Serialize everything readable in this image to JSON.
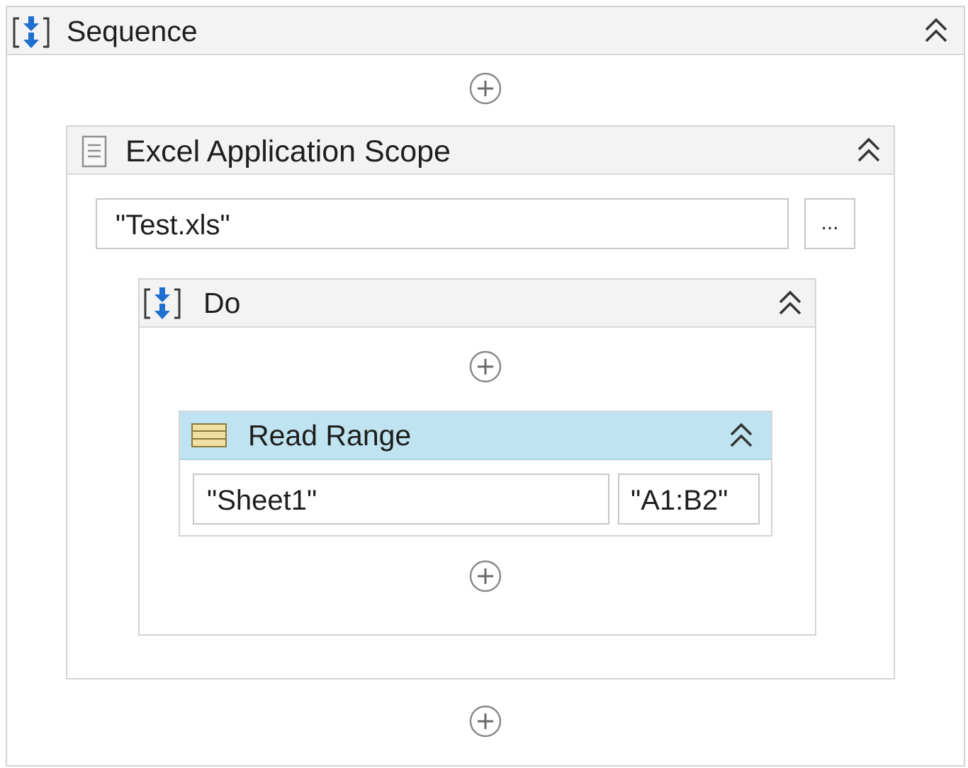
{
  "sequence": {
    "title": "Sequence",
    "icon": "sequence-icon",
    "collapse_icon": "collapse-icon"
  },
  "excel_scope": {
    "title": "Excel Application Scope",
    "icon": "document-icon",
    "collapse_icon": "collapse-icon",
    "workbook_path": "\"Test.xls\"",
    "browse_label": "..."
  },
  "do": {
    "title": "Do",
    "icon": "sequence-icon",
    "collapse_icon": "collapse-icon"
  },
  "read_range": {
    "title": "Read Range",
    "icon": "spreadsheet-range-icon",
    "collapse_icon": "collapse-icon",
    "sheet_name": "\"Sheet1\"",
    "range": "\"A1:B2\"",
    "header_color": "#bfe3f0"
  },
  "add_activity_icon": "add-activity-icon",
  "colors": {
    "header_bg": "#f3f3f3",
    "border": "#d4d4d4",
    "icon_blue": "#1f6fd1",
    "range_icon_fill": "#f0dfa0"
  }
}
